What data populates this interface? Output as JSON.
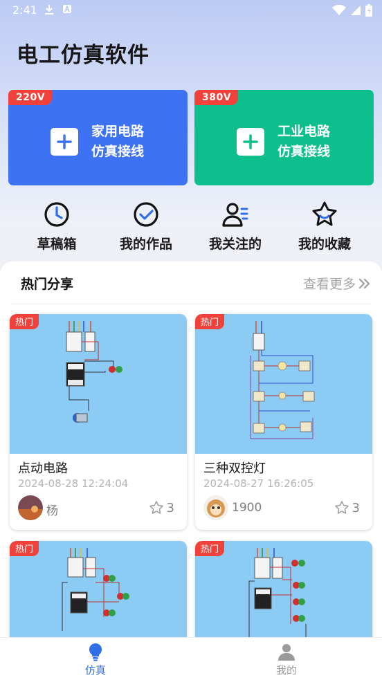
{
  "status_bar": {
    "time": "2:41"
  },
  "app": {
    "title": "电工仿真软件"
  },
  "feature_cards": [
    {
      "badge": "220V",
      "line1": "家用电路",
      "line2": "仿真接线",
      "color": "#3e72f4"
    },
    {
      "badge": "380V",
      "line1": "工业电路",
      "line2": "仿真接线",
      "color": "#0dbf8c"
    }
  ],
  "shortcuts": [
    {
      "label": "草稿箱",
      "icon": "clock-icon"
    },
    {
      "label": "我的作品",
      "icon": "check-circle-icon"
    },
    {
      "label": "我关注的",
      "icon": "user-list-icon"
    },
    {
      "label": "我的收藏",
      "icon": "star-face-icon"
    }
  ],
  "hot_section": {
    "title": "热门分享",
    "more": "查看更多"
  },
  "shares": [
    {
      "badge": "热门",
      "name": "点动电路",
      "date": "2024-08-28 12:24:04",
      "user": "杨",
      "stars": "3"
    },
    {
      "badge": "热门",
      "name": "三种双控灯",
      "date": "2024-08-27 16:26:05",
      "user": "1900",
      "stars": "3"
    },
    {
      "badge": "热门",
      "name": "",
      "date": "",
      "user": "",
      "stars": ""
    },
    {
      "badge": "热门",
      "name": "",
      "date": "",
      "user": "",
      "stars": ""
    }
  ],
  "bottom_nav": [
    {
      "label": "仿真",
      "icon": "lightbulb-icon",
      "active": true
    },
    {
      "label": "我的",
      "icon": "person-icon",
      "active": false
    }
  ],
  "colors": {
    "accent": "#2f6fe8",
    "badge": "#f0423a",
    "blue_card": "#3e72f4",
    "green_card": "#0dbf8c",
    "thumb_bg": "#8ccbf4"
  }
}
